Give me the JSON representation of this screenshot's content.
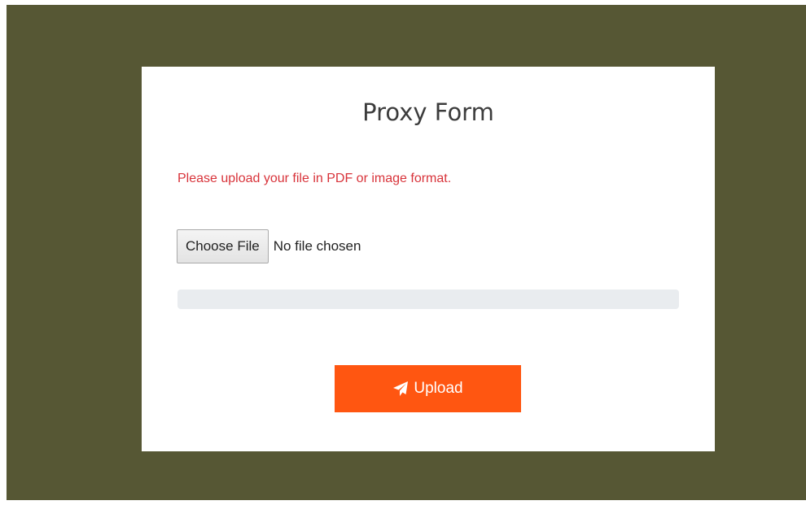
{
  "form": {
    "title": "Proxy Form",
    "notice": "Please upload your file in PDF or image format.",
    "file_input": {
      "button_label": "Choose File",
      "status_text": "No file chosen"
    },
    "progress": {
      "percent": 0
    },
    "upload_button": {
      "label": "Upload",
      "icon": "paper-plane-icon"
    }
  },
  "colors": {
    "backdrop": "#565734",
    "card": "#ffffff",
    "notice": "#d8333a",
    "accent": "#ff5611",
    "progress_track": "#e9ecef"
  }
}
